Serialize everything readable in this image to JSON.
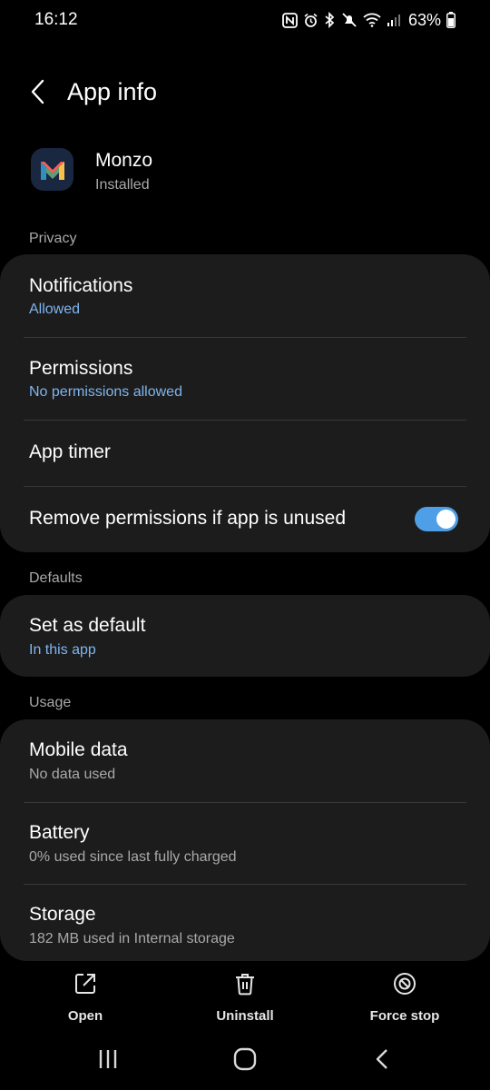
{
  "status_bar": {
    "time": "16:12",
    "battery_percent": "63%",
    "icons": [
      "nfc-icon",
      "alarm-icon",
      "bluetooth-icon",
      "mute-icon",
      "wifi-icon",
      "signal-icon",
      "battery-icon"
    ]
  },
  "header": {
    "title": "App info",
    "back_icon": "back-arrow-icon"
  },
  "app": {
    "name": "Monzo",
    "status": "Installed",
    "icon": "monzo-logo-icon"
  },
  "sections": {
    "privacy": {
      "label": "Privacy",
      "notifications": {
        "title": "Notifications",
        "subtitle": "Allowed"
      },
      "permissions": {
        "title": "Permissions",
        "subtitle": "No permissions allowed"
      },
      "app_timer": {
        "title": "App timer"
      },
      "remove_permissions": {
        "title": "Remove permissions if app is unused",
        "enabled": true
      }
    },
    "defaults": {
      "label": "Defaults",
      "set_default": {
        "title": "Set as default",
        "subtitle": "In this app"
      }
    },
    "usage": {
      "label": "Usage",
      "mobile_data": {
        "title": "Mobile data",
        "subtitle": "No data used"
      },
      "battery": {
        "title": "Battery",
        "subtitle": "0% used since last fully charged"
      },
      "storage": {
        "title": "Storage",
        "subtitle": "182 MB used in Internal storage"
      }
    }
  },
  "actions": {
    "open": {
      "label": "Open",
      "icon": "open-external-icon"
    },
    "uninstall": {
      "label": "Uninstall",
      "icon": "trash-icon"
    },
    "force_stop": {
      "label": "Force stop",
      "icon": "force-stop-icon"
    }
  },
  "nav": {
    "recents_icon": "recents-icon",
    "home_icon": "home-icon",
    "back_icon": "nav-back-icon"
  },
  "colors": {
    "background": "#000000",
    "card": "#1c1c1c",
    "accent_blue": "#7fb5ee",
    "toggle_on": "#4f9fe6",
    "secondary_text": "#a9a9a9"
  }
}
